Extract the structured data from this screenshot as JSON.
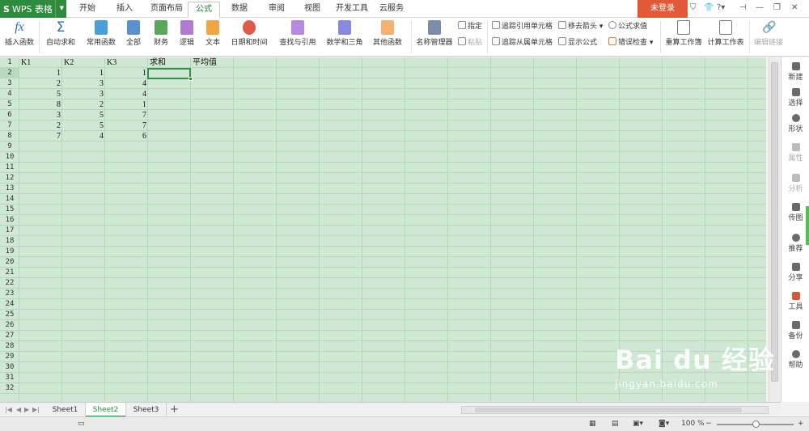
{
  "app": {
    "logo": "S",
    "name": "WPS 表格"
  },
  "menu_tabs": [
    "开始",
    "插入",
    "页面布局",
    "公式",
    "数据",
    "审阅",
    "视图",
    "开发工具",
    "云服务"
  ],
  "active_tab": "公式",
  "login_label": "未登录",
  "ribbon": {
    "insert_func": "插入函数",
    "autosum": "自动求和",
    "common": "常用函数",
    "all": "全部",
    "finance": "财务",
    "logic": "逻辑",
    "text": "文本",
    "datetime": "日期和时间",
    "lookup": "查找与引用",
    "math": "数学和三角",
    "other": "其他函数",
    "name_mgr": "名称管理器",
    "specify": "指定",
    "paste": "粘贴",
    "trace_prec": "追踪引用单元格",
    "trace_dep": "追踪从属单元格",
    "remove_arrows": "移去箭头",
    "show_formula": "显示公式",
    "eval_formula": "公式求值",
    "error_check": "错误检查",
    "recalc_book": "重算工作簿",
    "calc_sheet": "计算工作表",
    "edit_links": "编辑链接"
  },
  "grid": {
    "row_numbers": [
      "1",
      "2",
      "3",
      "4",
      "5",
      "6",
      "7",
      "8",
      "9",
      "10",
      "11",
      "12",
      "13",
      "14",
      "15",
      "16",
      "17",
      "18",
      "19",
      "20",
      "21",
      "22",
      "23",
      "24",
      "25",
      "26",
      "27",
      "28",
      "29",
      "30",
      "31",
      "32"
    ],
    "headers": [
      "K1",
      "K2",
      "K3",
      "求和",
      "平均值"
    ],
    "rows": [
      [
        "1",
        "1",
        "1"
      ],
      [
        "2",
        "3",
        "4"
      ],
      [
        "5",
        "3",
        "4"
      ],
      [
        "8",
        "2",
        "1"
      ],
      [
        "3",
        "5",
        "7"
      ],
      [
        "2",
        "5",
        "7"
      ],
      [
        "7",
        "4",
        "6"
      ]
    ]
  },
  "right_panel": [
    "新建",
    "选择",
    "形状",
    "属性",
    "分析",
    "传图",
    "推荐",
    "分享",
    "工具",
    "备份",
    "帮助"
  ],
  "sheets": [
    "Sheet1",
    "Sheet2",
    "Sheet3"
  ],
  "active_sheet": "Sheet2",
  "zoom": "100 %",
  "watermark": {
    "brand": "Bai du 经验",
    "url": "jingyan.baidu.com"
  },
  "colors": {
    "accent": "#2e8b3e",
    "grid_bg": "#cfe8d3",
    "login": "#e05a3a"
  }
}
